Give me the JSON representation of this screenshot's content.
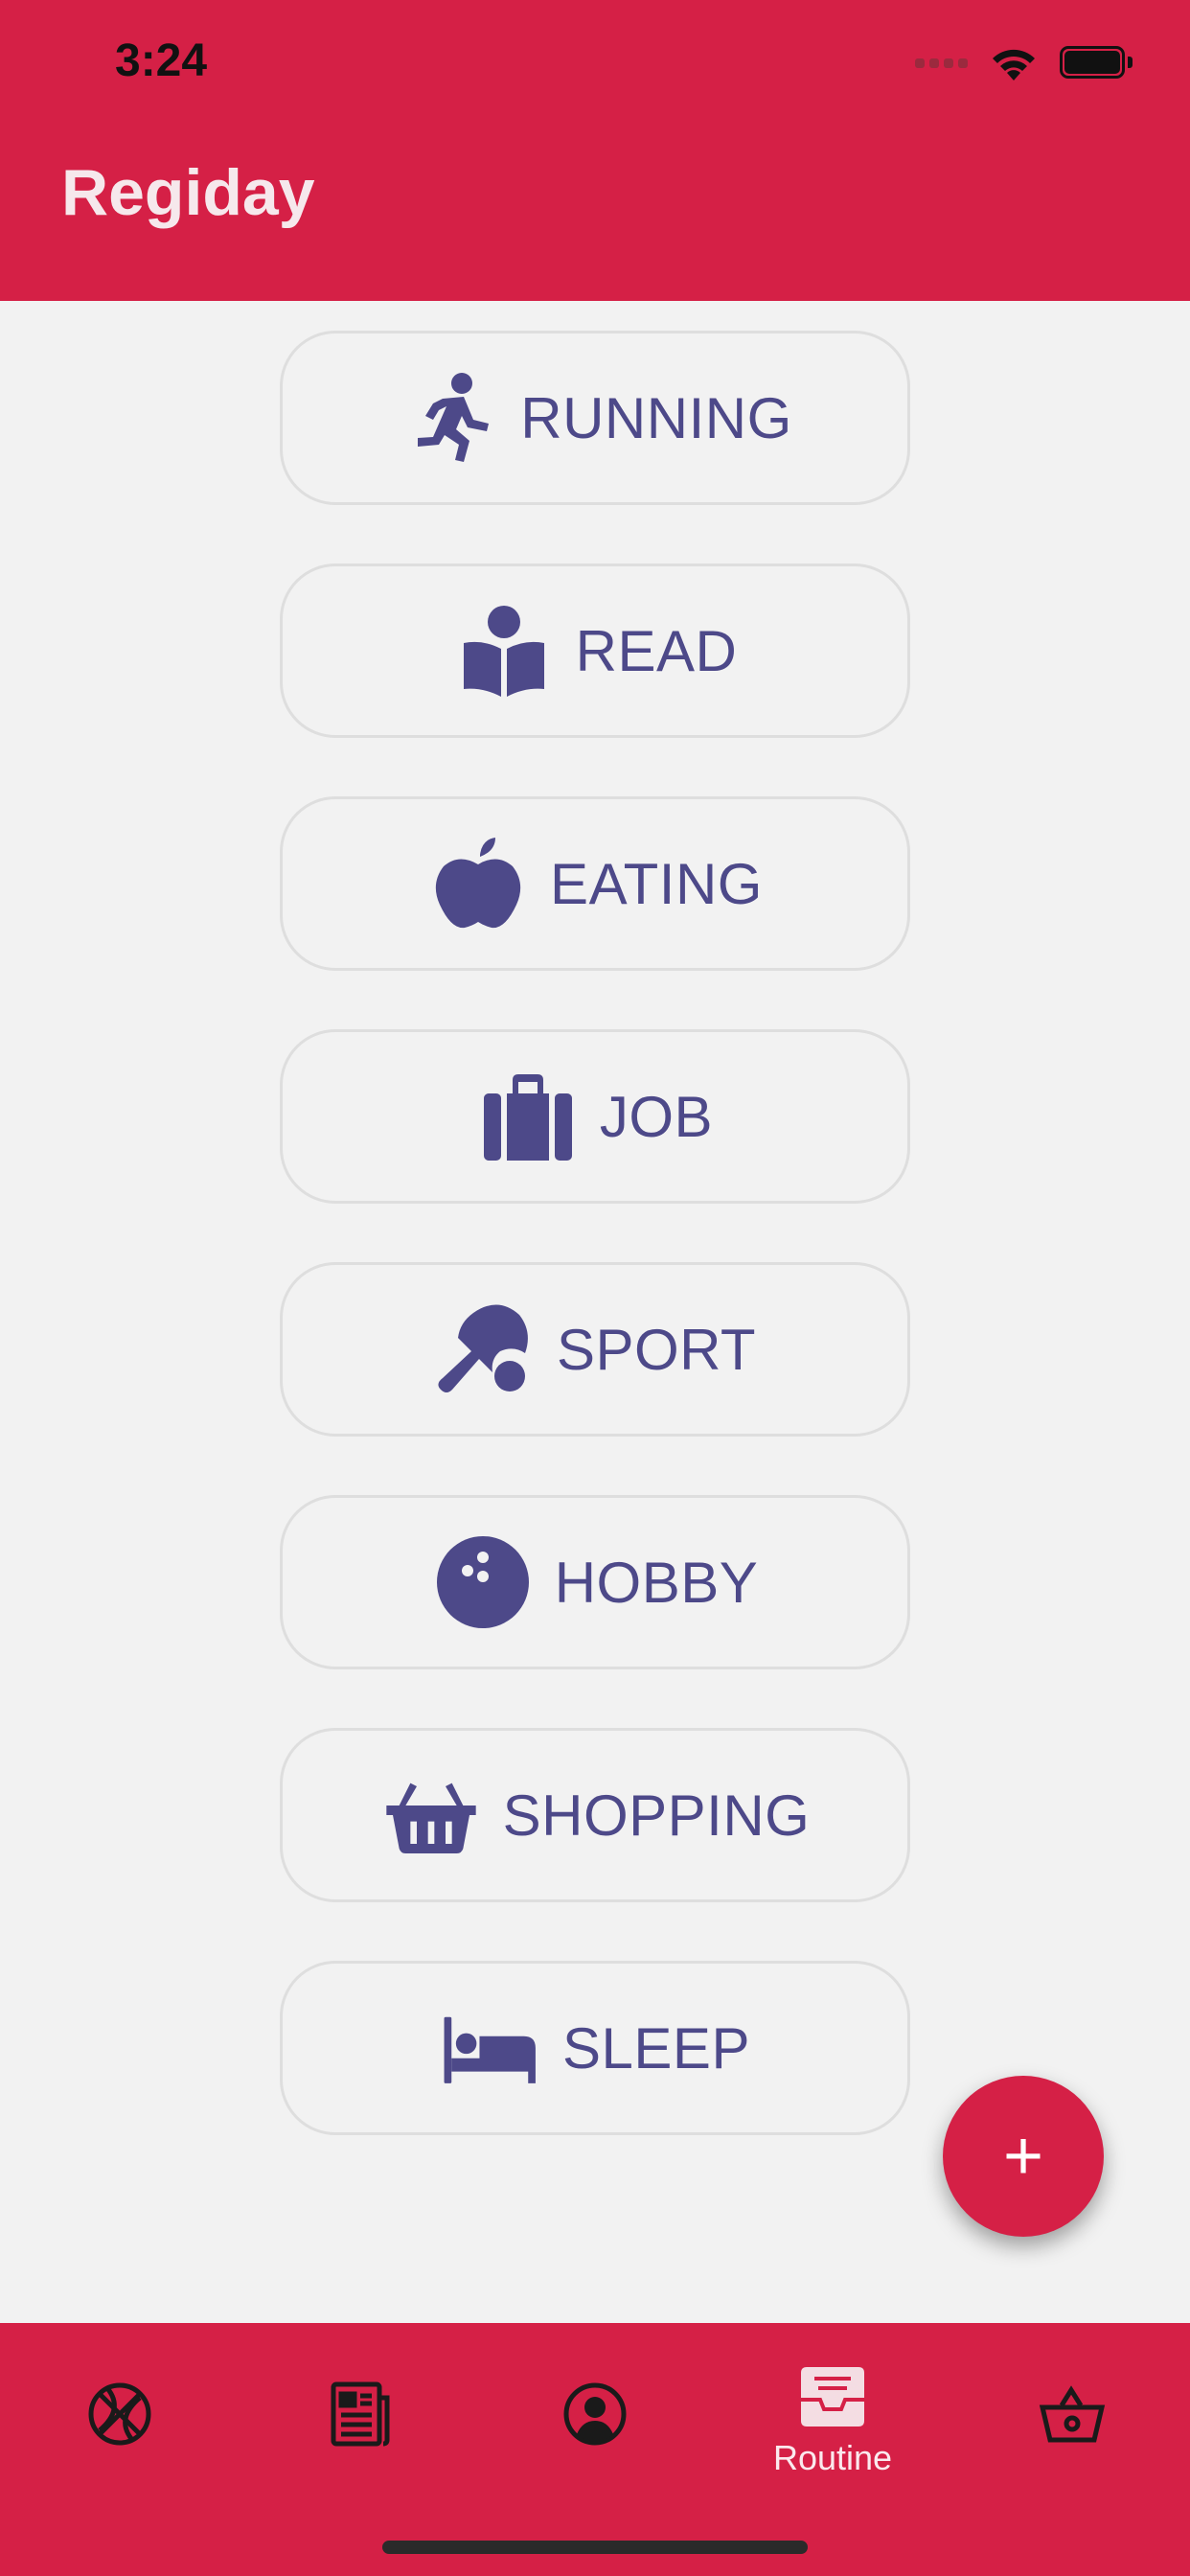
{
  "status_bar": {
    "time": "3:24"
  },
  "header": {
    "title": "Regiday"
  },
  "routines": [
    {
      "label": "RUNNING",
      "icon": "running-icon"
    },
    {
      "label": "READ",
      "icon": "book-reader-icon"
    },
    {
      "label": "EATING",
      "icon": "apple-icon"
    },
    {
      "label": "JOB",
      "icon": "suitcase-icon"
    },
    {
      "label": "SPORT",
      "icon": "table-tennis-icon"
    },
    {
      "label": "HOBBY",
      "icon": "bowling-ball-icon"
    },
    {
      "label": "SHOPPING",
      "icon": "shopping-basket-icon"
    },
    {
      "label": "SLEEP",
      "icon": "bed-icon"
    }
  ],
  "fab": {
    "label": "+"
  },
  "bottom_nav": {
    "items": [
      {
        "icon": "basketball-icon",
        "label": ""
      },
      {
        "icon": "newspaper-icon",
        "label": ""
      },
      {
        "icon": "user-circle-icon",
        "label": ""
      },
      {
        "icon": "inbox-icon",
        "label": "Routine",
        "active": true
      },
      {
        "icon": "basket-icon",
        "label": ""
      }
    ]
  },
  "colors": {
    "primary": "#d52046",
    "accent": "#4d4989",
    "background": "#f2f2f2"
  }
}
